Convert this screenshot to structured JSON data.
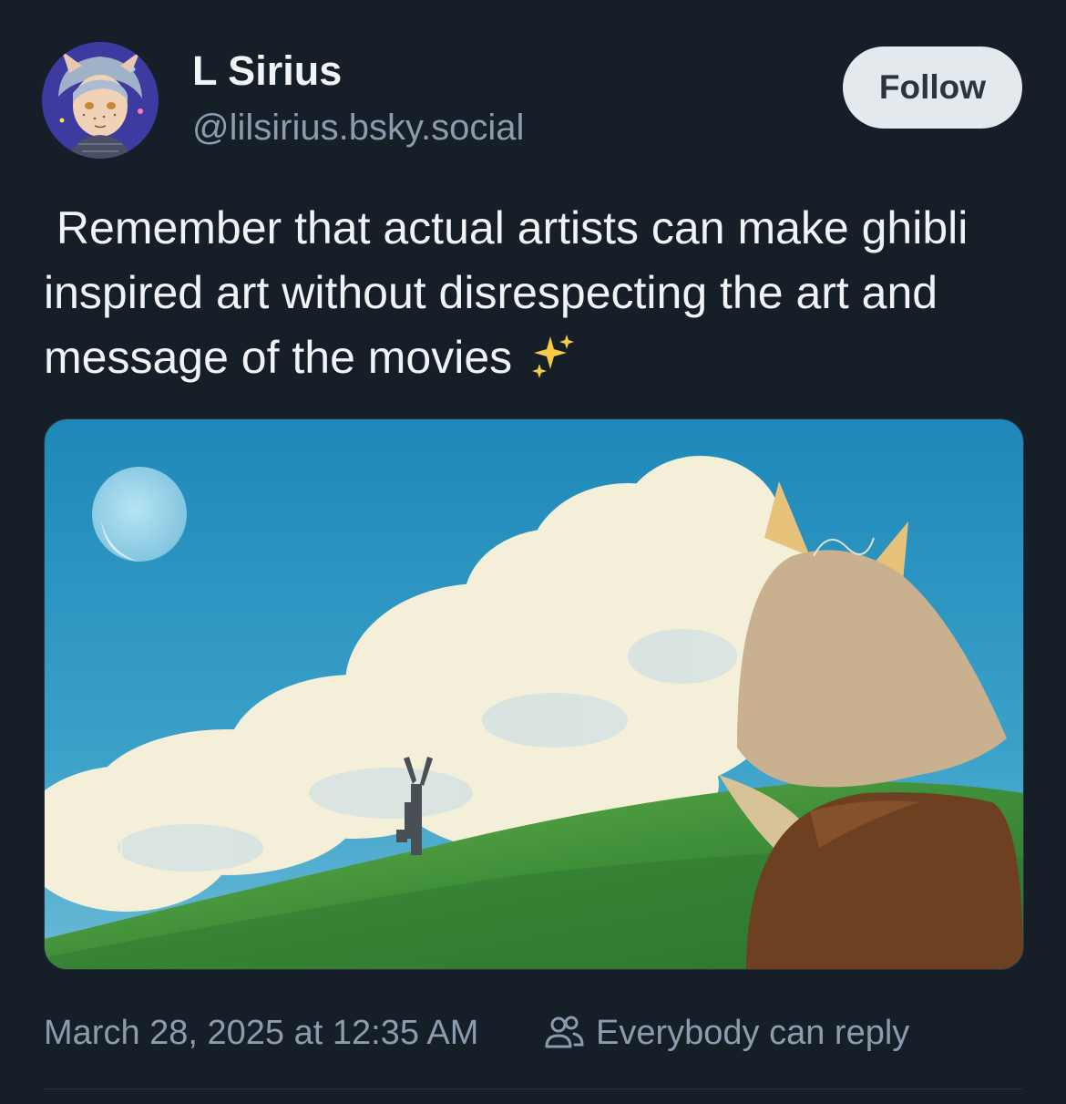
{
  "post": {
    "author": {
      "display_name": "L Sirius",
      "handle": "@lilsirius.bsky.social"
    },
    "follow_label": "Follow",
    "text": " Remember that actual artists can make ghibli inspired art without disrespecting the art and message of the movies",
    "text_emoji_icon": "sparkles-icon",
    "timestamp": "March 28, 2025 at 12:35 AM",
    "reply_setting": {
      "icon": "people-icon",
      "label": "Everybody can reply"
    }
  },
  "colors": {
    "background": "#161e27",
    "primary_text": "#f1f3f5",
    "secondary_text": "#8c9bad",
    "follow_button_bg": "#e4e9ee",
    "follow_button_text": "#2b3540"
  }
}
